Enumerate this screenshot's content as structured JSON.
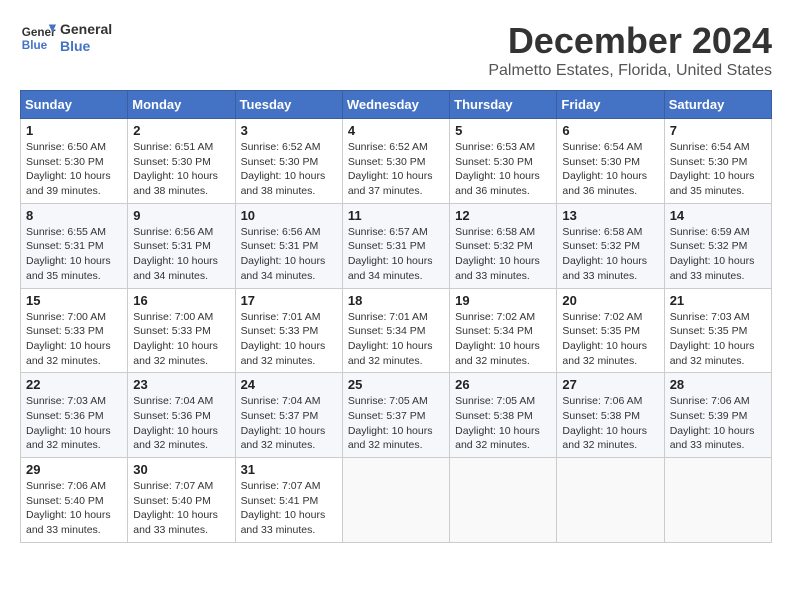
{
  "header": {
    "logo_line1": "General",
    "logo_line2": "Blue",
    "month_title": "December 2024",
    "location": "Palmetto Estates, Florida, United States"
  },
  "weekdays": [
    "Sunday",
    "Monday",
    "Tuesday",
    "Wednesday",
    "Thursday",
    "Friday",
    "Saturday"
  ],
  "weeks": [
    [
      {
        "day": "1",
        "info": "Sunrise: 6:50 AM\nSunset: 5:30 PM\nDaylight: 10 hours\nand 39 minutes."
      },
      {
        "day": "2",
        "info": "Sunrise: 6:51 AM\nSunset: 5:30 PM\nDaylight: 10 hours\nand 38 minutes."
      },
      {
        "day": "3",
        "info": "Sunrise: 6:52 AM\nSunset: 5:30 PM\nDaylight: 10 hours\nand 38 minutes."
      },
      {
        "day": "4",
        "info": "Sunrise: 6:52 AM\nSunset: 5:30 PM\nDaylight: 10 hours\nand 37 minutes."
      },
      {
        "day": "5",
        "info": "Sunrise: 6:53 AM\nSunset: 5:30 PM\nDaylight: 10 hours\nand 36 minutes."
      },
      {
        "day": "6",
        "info": "Sunrise: 6:54 AM\nSunset: 5:30 PM\nDaylight: 10 hours\nand 36 minutes."
      },
      {
        "day": "7",
        "info": "Sunrise: 6:54 AM\nSunset: 5:30 PM\nDaylight: 10 hours\nand 35 minutes."
      }
    ],
    [
      {
        "day": "8",
        "info": "Sunrise: 6:55 AM\nSunset: 5:31 PM\nDaylight: 10 hours\nand 35 minutes."
      },
      {
        "day": "9",
        "info": "Sunrise: 6:56 AM\nSunset: 5:31 PM\nDaylight: 10 hours\nand 34 minutes."
      },
      {
        "day": "10",
        "info": "Sunrise: 6:56 AM\nSunset: 5:31 PM\nDaylight: 10 hours\nand 34 minutes."
      },
      {
        "day": "11",
        "info": "Sunrise: 6:57 AM\nSunset: 5:31 PM\nDaylight: 10 hours\nand 34 minutes."
      },
      {
        "day": "12",
        "info": "Sunrise: 6:58 AM\nSunset: 5:32 PM\nDaylight: 10 hours\nand 33 minutes."
      },
      {
        "day": "13",
        "info": "Sunrise: 6:58 AM\nSunset: 5:32 PM\nDaylight: 10 hours\nand 33 minutes."
      },
      {
        "day": "14",
        "info": "Sunrise: 6:59 AM\nSunset: 5:32 PM\nDaylight: 10 hours\nand 33 minutes."
      }
    ],
    [
      {
        "day": "15",
        "info": "Sunrise: 7:00 AM\nSunset: 5:33 PM\nDaylight: 10 hours\nand 32 minutes."
      },
      {
        "day": "16",
        "info": "Sunrise: 7:00 AM\nSunset: 5:33 PM\nDaylight: 10 hours\nand 32 minutes."
      },
      {
        "day": "17",
        "info": "Sunrise: 7:01 AM\nSunset: 5:33 PM\nDaylight: 10 hours\nand 32 minutes."
      },
      {
        "day": "18",
        "info": "Sunrise: 7:01 AM\nSunset: 5:34 PM\nDaylight: 10 hours\nand 32 minutes."
      },
      {
        "day": "19",
        "info": "Sunrise: 7:02 AM\nSunset: 5:34 PM\nDaylight: 10 hours\nand 32 minutes."
      },
      {
        "day": "20",
        "info": "Sunrise: 7:02 AM\nSunset: 5:35 PM\nDaylight: 10 hours\nand 32 minutes."
      },
      {
        "day": "21",
        "info": "Sunrise: 7:03 AM\nSunset: 5:35 PM\nDaylight: 10 hours\nand 32 minutes."
      }
    ],
    [
      {
        "day": "22",
        "info": "Sunrise: 7:03 AM\nSunset: 5:36 PM\nDaylight: 10 hours\nand 32 minutes."
      },
      {
        "day": "23",
        "info": "Sunrise: 7:04 AM\nSunset: 5:36 PM\nDaylight: 10 hours\nand 32 minutes."
      },
      {
        "day": "24",
        "info": "Sunrise: 7:04 AM\nSunset: 5:37 PM\nDaylight: 10 hours\nand 32 minutes."
      },
      {
        "day": "25",
        "info": "Sunrise: 7:05 AM\nSunset: 5:37 PM\nDaylight: 10 hours\nand 32 minutes."
      },
      {
        "day": "26",
        "info": "Sunrise: 7:05 AM\nSunset: 5:38 PM\nDaylight: 10 hours\nand 32 minutes."
      },
      {
        "day": "27",
        "info": "Sunrise: 7:06 AM\nSunset: 5:38 PM\nDaylight: 10 hours\nand 32 minutes."
      },
      {
        "day": "28",
        "info": "Sunrise: 7:06 AM\nSunset: 5:39 PM\nDaylight: 10 hours\nand 33 minutes."
      }
    ],
    [
      {
        "day": "29",
        "info": "Sunrise: 7:06 AM\nSunset: 5:40 PM\nDaylight: 10 hours\nand 33 minutes."
      },
      {
        "day": "30",
        "info": "Sunrise: 7:07 AM\nSunset: 5:40 PM\nDaylight: 10 hours\nand 33 minutes."
      },
      {
        "day": "31",
        "info": "Sunrise: 7:07 AM\nSunset: 5:41 PM\nDaylight: 10 hours\nand 33 minutes."
      },
      null,
      null,
      null,
      null
    ]
  ]
}
